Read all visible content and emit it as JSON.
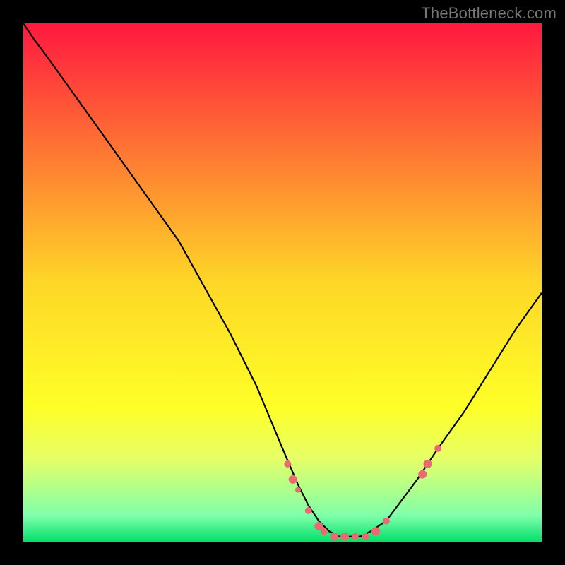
{
  "watermark": "TheBottleneck.com",
  "chart_data": {
    "type": "line",
    "title": "",
    "xlabel": "",
    "ylabel": "",
    "xlim": [
      0,
      100
    ],
    "ylim": [
      0,
      100
    ],
    "grid": false,
    "legend": false,
    "background_gradient": {
      "stops": [
        {
          "offset": 0.0,
          "color": "#ff183f"
        },
        {
          "offset": 0.5,
          "color": "#fed727"
        },
        {
          "offset": 0.74,
          "color": "#feff27"
        },
        {
          "offset": 0.84,
          "color": "#e6ff67"
        },
        {
          "offset": 0.95,
          "color": "#7fffaa"
        },
        {
          "offset": 1.0,
          "color": "#00e06a"
        }
      ]
    },
    "series": [
      {
        "name": "bottleneck-curve",
        "color": "#000000",
        "x": [
          0,
          2,
          5,
          10,
          15,
          20,
          25,
          30,
          35,
          40,
          45,
          50,
          53,
          55,
          57,
          59,
          61,
          63,
          65,
          67,
          70,
          73,
          76,
          80,
          85,
          90,
          95,
          100
        ],
        "y": [
          100,
          97,
          93,
          86,
          79,
          72,
          65,
          58,
          49,
          40,
          30,
          18,
          11,
          7,
          4,
          2,
          1,
          1,
          1,
          2,
          4,
          8,
          12,
          18,
          25,
          33,
          41,
          48
        ]
      }
    ],
    "points": {
      "name": "highlighted-points",
      "color": "#e86b71",
      "data": [
        {
          "x": 51,
          "y": 15,
          "r": 5
        },
        {
          "x": 52,
          "y": 12,
          "r": 6
        },
        {
          "x": 53,
          "y": 10,
          "r": 4
        },
        {
          "x": 55,
          "y": 6,
          "r": 5
        },
        {
          "x": 57,
          "y": 3,
          "r": 6
        },
        {
          "x": 58,
          "y": 2,
          "r": 5
        },
        {
          "x": 60,
          "y": 1,
          "r": 6
        },
        {
          "x": 62,
          "y": 1,
          "r": 6
        },
        {
          "x": 64,
          "y": 1,
          "r": 5
        },
        {
          "x": 66,
          "y": 1,
          "r": 5
        },
        {
          "x": 68,
          "y": 2,
          "r": 6
        },
        {
          "x": 70,
          "y": 4,
          "r": 5
        },
        {
          "x": 77,
          "y": 13,
          "r": 6
        },
        {
          "x": 78,
          "y": 15,
          "r": 6
        },
        {
          "x": 80,
          "y": 18,
          "r": 5
        }
      ]
    }
  }
}
